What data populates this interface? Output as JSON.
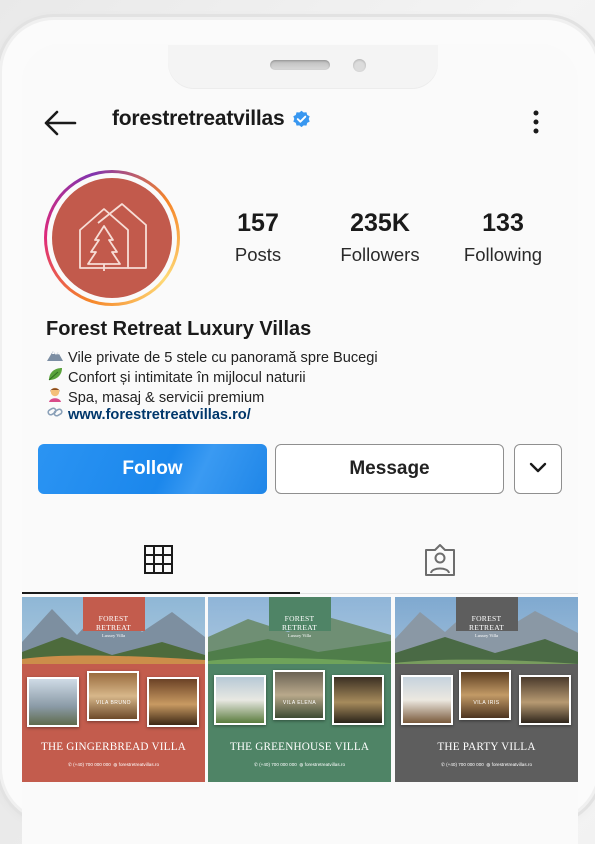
{
  "profile": {
    "handle": "forestretreatvillas",
    "verified": true,
    "stats": [
      {
        "value": "157",
        "label": "Posts"
      },
      {
        "value": "235K",
        "label": "Followers"
      },
      {
        "value": "133",
        "label": "Following"
      }
    ],
    "name": "Forest Retreat Luxury Villas",
    "bio": [
      {
        "icon": "mountain-icon",
        "text": "Vile private de 5 stele cu panoramă spre Bucegi"
      },
      {
        "icon": "leaf-icon",
        "text": "Confort și intimitate în mijlocul naturii"
      },
      {
        "icon": "spa-person-icon",
        "text": "Spa, masaj & servicii premium"
      }
    ],
    "link": "www.forestretreatvillas.ro/"
  },
  "actions": {
    "follow": "Follow",
    "message": "Message"
  },
  "tabs": [
    {
      "name": "grid-icon",
      "active": true
    },
    {
      "name": "tagged-icon",
      "active": false
    }
  ],
  "posts": [
    {
      "brand": "FOREST RETREAT",
      "brand_sub": "Luxury Villa",
      "vila": "VILA BRUNO",
      "title": "THE GINGERBREAD VILLA",
      "phone": "(+40) 700 000 000",
      "web": "forestretreatvillas.ro",
      "color": "#c35c4d"
    },
    {
      "brand": "FOREST RETREAT",
      "brand_sub": "Luxury Villa",
      "vila": "VILA ELENA",
      "title": "THE GREENHOUSE VILLA",
      "phone": "(+40) 700 000 000",
      "web": "forestretreatvillas.ro",
      "color": "#4f8466"
    },
    {
      "brand": "FOREST RETREAT",
      "brand_sub": "Luxury Villa",
      "vila": "VILA IRIS",
      "title": "THE PARTY VILLA",
      "phone": "(+40) 700 000 000",
      "web": "forestretreatvillas.ro",
      "color": "#5e5e5e"
    }
  ],
  "colors": {
    "accent": "#1b87ec",
    "avatar": "#c25a4c",
    "link": "#00376b"
  }
}
